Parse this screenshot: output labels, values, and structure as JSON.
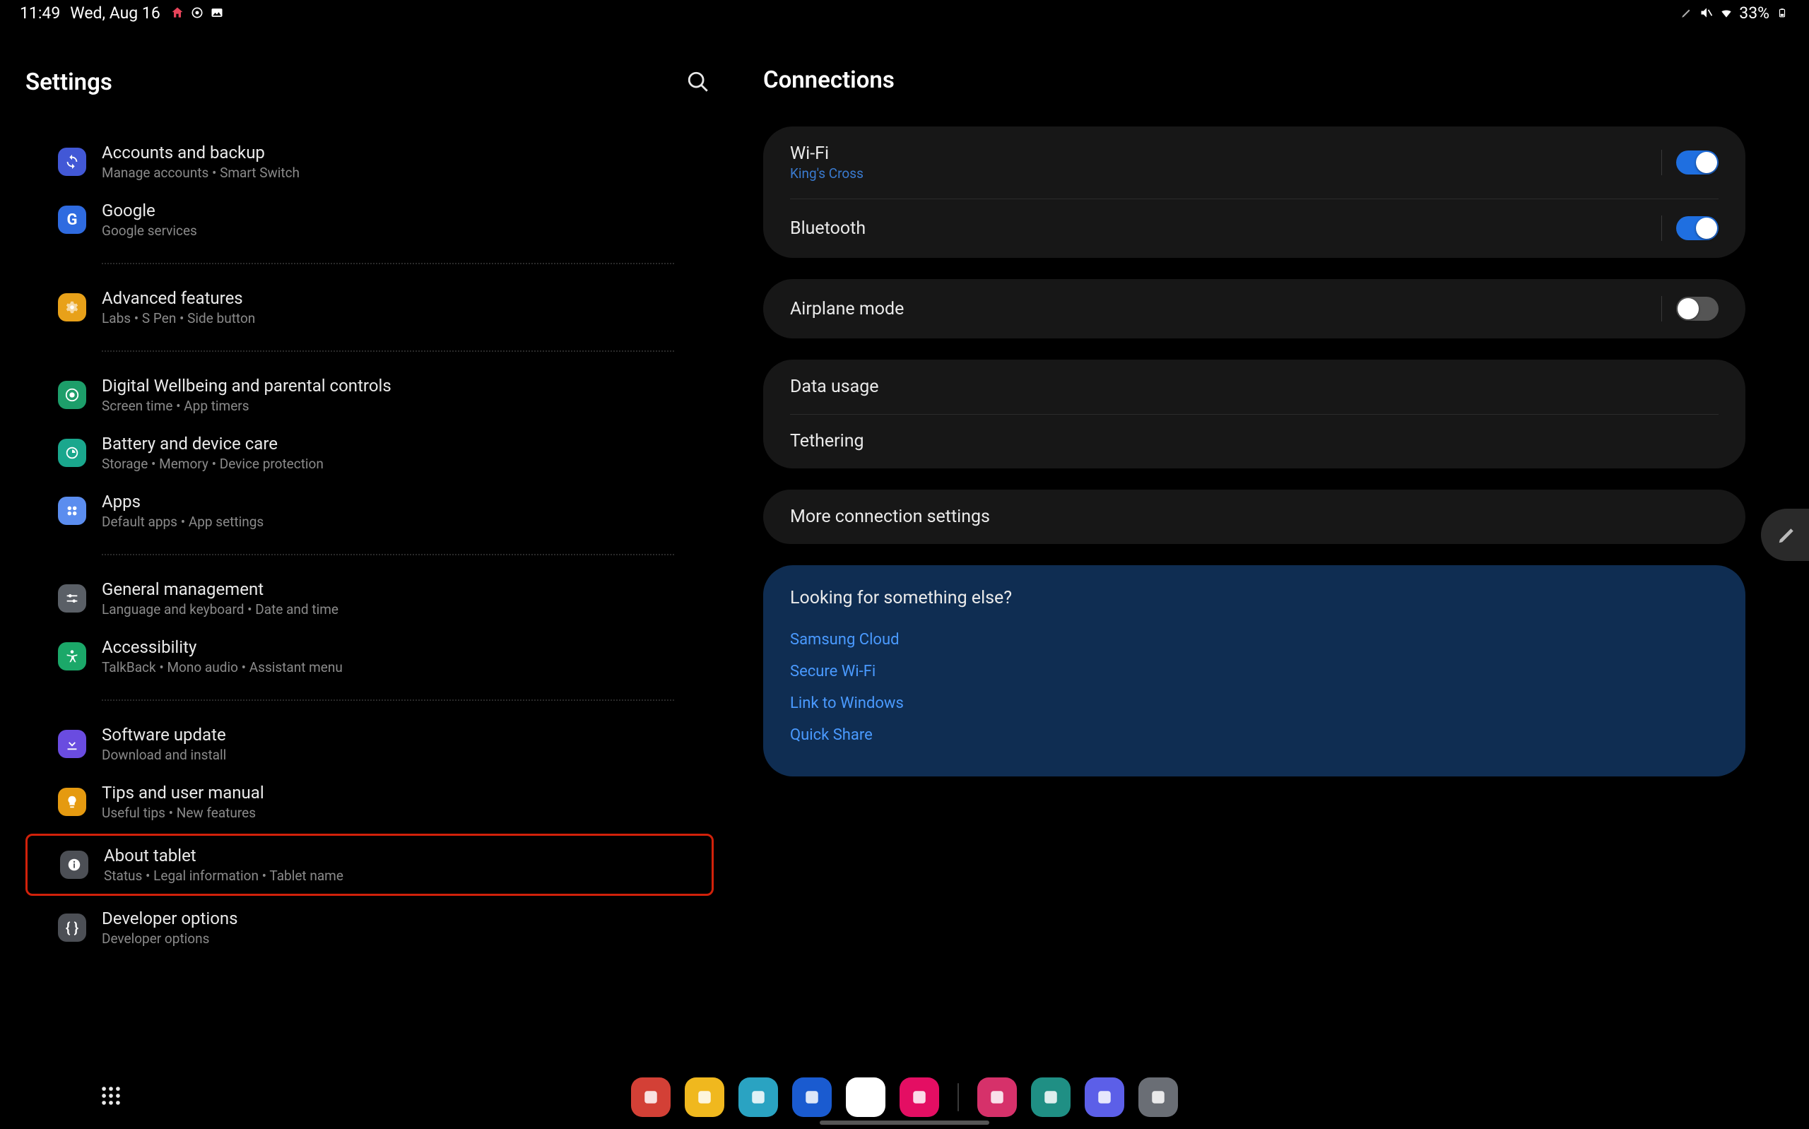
{
  "status": {
    "time": "11:49",
    "date": "Wed, Aug 16",
    "battery_pct": "33%"
  },
  "left": {
    "title": "Settings",
    "items": [
      {
        "title": "Accounts and backup",
        "sub": "Manage accounts  •  Smart Switch",
        "icon": "sync-icon",
        "color": "bg-indigo"
      },
      {
        "title": "Google",
        "sub": "Google services",
        "icon": "google-icon",
        "color": "bg-blue"
      }
    ],
    "group2": [
      {
        "title": "Advanced features",
        "sub": "Labs  •  S Pen  •  Side button",
        "icon": "gear-icon",
        "color": "bg-orange"
      }
    ],
    "group3": [
      {
        "title": "Digital Wellbeing and parental controls",
        "sub": "Screen time  •  App timers",
        "icon": "wellbeing-icon",
        "color": "bg-green"
      },
      {
        "title": "Battery and device care",
        "sub": "Storage  •  Memory  •  Device protection",
        "icon": "care-icon",
        "color": "bg-teal"
      },
      {
        "title": "Apps",
        "sub": "Default apps  •  App settings",
        "icon": "apps-icon",
        "color": "bg-lightblue"
      }
    ],
    "group4": [
      {
        "title": "General management",
        "sub": "Language and keyboard  •  Date and time",
        "icon": "sliders-icon",
        "color": "bg-gray"
      },
      {
        "title": "Accessibility",
        "sub": "TalkBack  •  Mono audio  •  Assistant menu",
        "icon": "accessibility-icon",
        "color": "bg-greenacc"
      }
    ],
    "group5": [
      {
        "title": "Software update",
        "sub": "Download and install",
        "icon": "download-icon",
        "color": "bg-purple"
      },
      {
        "title": "Tips and user manual",
        "sub": "Useful tips  •  New features",
        "icon": "bulb-icon",
        "color": "bg-amber"
      },
      {
        "title": "About tablet",
        "sub": "Status  •  Legal information  •  Tablet name",
        "icon": "info-icon",
        "color": "bg-darkgray",
        "highlighted": true
      },
      {
        "title": "Developer options",
        "sub": "Developer options",
        "icon": "braces-icon",
        "color": "bg-darkgray"
      }
    ]
  },
  "right": {
    "title": "Connections",
    "card1": [
      {
        "title": "Wi-Fi",
        "sub": "King's Cross",
        "toggle": true,
        "on": true
      },
      {
        "title": "Bluetooth",
        "toggle": true,
        "on": true
      }
    ],
    "card2": [
      {
        "title": "Airplane mode",
        "toggle": true,
        "on": false
      }
    ],
    "card3": [
      {
        "title": "Data usage"
      },
      {
        "title": "Tethering"
      }
    ],
    "card4": [
      {
        "title": "More connection settings"
      }
    ],
    "suggest": {
      "title": "Looking for something else?",
      "links": [
        "Samsung Cloud",
        "Secure Wi-Fi",
        "Link to Windows",
        "Quick Share"
      ]
    }
  },
  "dock": {
    "apps": [
      {
        "name": "notes-app",
        "color": "#d34036"
      },
      {
        "name": "files-app",
        "color": "#f0b81e"
      },
      {
        "name": "calendar-app",
        "color": "#2aa3c2"
      },
      {
        "name": "messages-app",
        "color": "#1a5bd0"
      },
      {
        "name": "chrome-app",
        "color": "#ffffff"
      },
      {
        "name": "camera-app",
        "color": "#e40e63"
      }
    ],
    "recent": [
      {
        "name": "zoom-app",
        "color": "#d6316a"
      },
      {
        "name": "teams-app",
        "color": "#1f8f84"
      },
      {
        "name": "grid-app",
        "color": "#5c5fe8"
      },
      {
        "name": "settings-app",
        "color": "#6a6e75"
      }
    ]
  }
}
